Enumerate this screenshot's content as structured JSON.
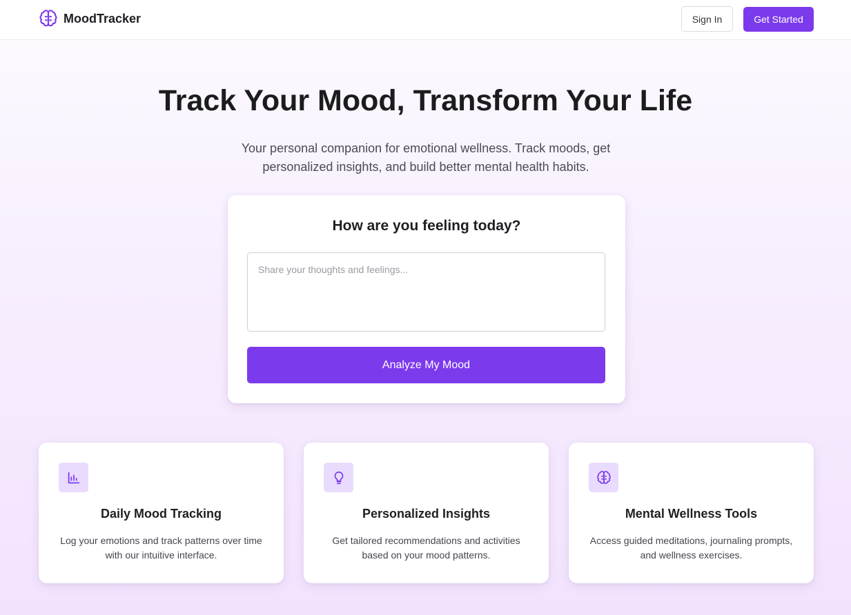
{
  "colors": {
    "accent": "#7c3aed",
    "icon_bg": "#e9dbfd"
  },
  "header": {
    "brand_icon": "brain-icon",
    "brand_name": "MoodTracker",
    "signin_label": "Sign In",
    "get_started_label": "Get Started"
  },
  "hero": {
    "title": "Track Your Mood, Transform Your Life",
    "subtitle": "Your personal companion for emotional wellness. Track moods, get personalized insights, and build better mental health habits."
  },
  "mood_card": {
    "title": "How are you feeling today?",
    "input_value": "",
    "input_placeholder": "Share your thoughts and feelings...",
    "button_label": "Analyze My Mood"
  },
  "features": [
    {
      "icon": "bar-chart-icon",
      "title": "Daily Mood Tracking",
      "description": "Log your emotions and track patterns over time with our intuitive interface."
    },
    {
      "icon": "lightbulb-icon",
      "title": "Personalized Insights",
      "description": "Get tailored recommendations and activities based on your mood patterns."
    },
    {
      "icon": "brain-icon",
      "title": "Mental Wellness Tools",
      "description": "Access guided meditations, journaling prompts, and wellness exercises."
    }
  ]
}
